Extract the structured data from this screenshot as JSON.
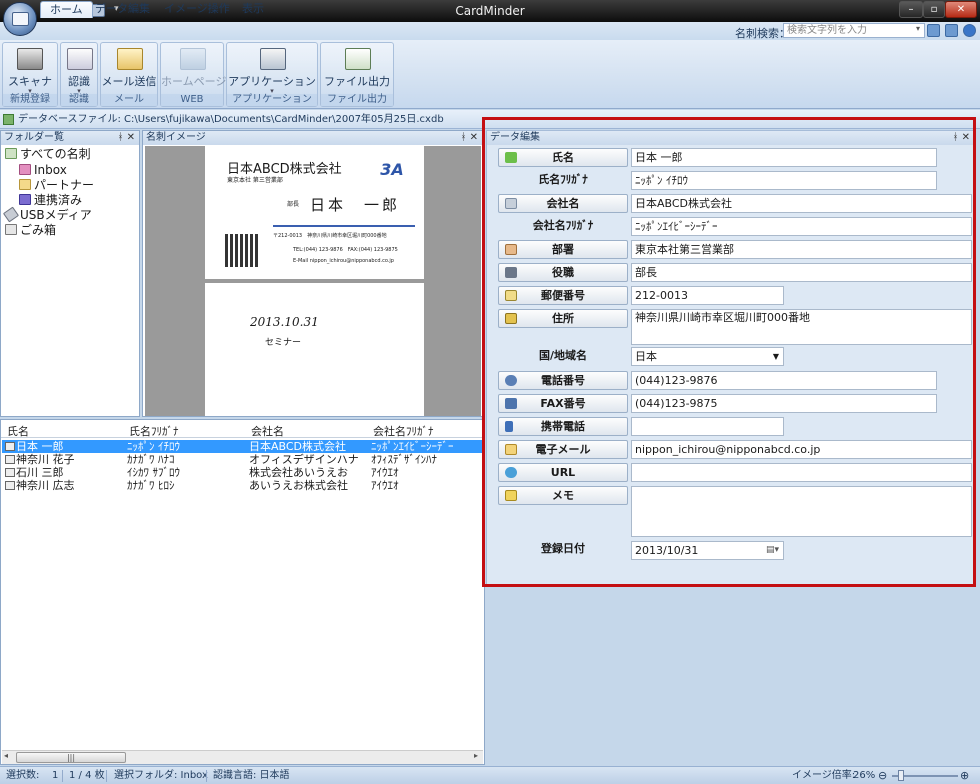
{
  "window": {
    "title": "CardMinder"
  },
  "tabs": [
    "ホーム",
    "データ編集",
    "イメージ操作",
    "表示"
  ],
  "search": {
    "label": "名刺検索：",
    "placeholder": "検索文字列を入力"
  },
  "ribbon": {
    "groups": [
      {
        "button": "スキャナ",
        "caption": "新規登録"
      },
      {
        "button": "認識",
        "caption": "認識"
      },
      {
        "button": "メール送信",
        "caption": "メール"
      },
      {
        "button": "ホームページ",
        "caption": "WEB"
      },
      {
        "button": "アプリケーション",
        "caption": "アプリケーション"
      },
      {
        "button": "ファイル出力",
        "caption": "ファイル出力"
      }
    ]
  },
  "pathbar": {
    "text": "データベースファイル: C:\\Users\\fujikawa\\Documents\\CardMinder\\2007年05月25日.cxdb"
  },
  "folder_pane": {
    "title": "フォルダー覧",
    "items": [
      "すべての名刺",
      "Inbox",
      "パートナー",
      "連携済み",
      "USBメディア",
      "ごみ箱"
    ]
  },
  "card_pane": {
    "title": "名刺イメージ",
    "front": {
      "company": "日本ABCD株式会社",
      "dept": "東京本社 第三営業部",
      "position": "部長",
      "name": "日本　一郎",
      "address": "〒212-0013　神奈川県川崎市幸区堀川町000番地",
      "tel": "TEL:(044) 123-9876　FAX:(044) 123-9875",
      "email": "E-Mail nippon_ichirou@nipponabcd.co.jp"
    },
    "back": {
      "date": "2013.10.31",
      "note": "セミナー"
    }
  },
  "list": {
    "headers": [
      "氏名",
      "氏名ﾌﾘｶﾞﾅ",
      "会社名",
      "会社名ﾌﾘｶﾞﾅ"
    ],
    "rows": [
      [
        "日本 一郎",
        "ﾆｯﾎﾟﾝ ｲﾁﾛｳ",
        "日本ABCD株式会社",
        "ﾆｯﾎﾟﾝｴｲﾋﾞｰｼｰﾃﾞｰ"
      ],
      [
        "神奈川 花子",
        "ｶﾅｶﾞﾜ ﾊﾅｺ",
        "オフィスデザインハナ",
        "ｵﾌｨｽﾃﾞｻﾞｲﾝﾊﾅ"
      ],
      [
        "石川 三郎",
        "ｲｼｶﾜ ｻﾌﾞﾛｳ",
        "株式会社あいうえお",
        "ｱｲｳｴｵ"
      ],
      [
        "神奈川 広志",
        "ｶﾅｶﾞﾜ ﾋﾛｼ",
        "あいうえお株式会社",
        "ｱｲｳｴｵ"
      ]
    ]
  },
  "data_edit": {
    "title": "データ編集",
    "fields": {
      "name": {
        "label": "氏名",
        "value": "日本 一郎"
      },
      "name_kana": {
        "label": "氏名ﾌﾘｶﾞﾅ",
        "value": "ﾆｯﾎﾟﾝ ｲﾁﾛｳ"
      },
      "company": {
        "label": "会社名",
        "value": "日本ABCD株式会社"
      },
      "company_kana": {
        "label": "会社名ﾌﾘｶﾞﾅ",
        "value": "ﾆｯﾎﾟﾝｴｲﾋﾞｰｼｰﾃﾞｰ"
      },
      "dept": {
        "label": "部署",
        "value": "東京本社第三営業部"
      },
      "position": {
        "label": "役職",
        "value": "部長"
      },
      "postal": {
        "label": "郵便番号",
        "value": "212-0013"
      },
      "address": {
        "label": "住所",
        "value": "神奈川県川崎市幸区堀川町000番地"
      },
      "country": {
        "label": "国/地域名",
        "value": "日本"
      },
      "phone": {
        "label": "電話番号",
        "value": "(044)123-9876"
      },
      "fax": {
        "label": "FAX番号",
        "value": "(044)123-9875"
      },
      "mobile": {
        "label": "携帯電話",
        "value": ""
      },
      "email": {
        "label": "電子メール",
        "value": "nippon_ichirou@nipponabcd.co.jp"
      },
      "url": {
        "label": "URL",
        "value": ""
      },
      "memo": {
        "label": "メモ",
        "value": ""
      },
      "reg_date": {
        "label": "登録日付",
        "value": "2013/10/31"
      }
    }
  },
  "status": {
    "selected": "選択数:",
    "selected_count": "1",
    "page": "1 / 4 枚",
    "folder": "選択フォルダ: Inbox",
    "lang": "認識言語: 日本語",
    "zoom_label": "イメージ倍率:",
    "zoom": "26%"
  },
  "colors": {
    "accent": "#3399ff",
    "highlight_frame": "#c40e12"
  }
}
